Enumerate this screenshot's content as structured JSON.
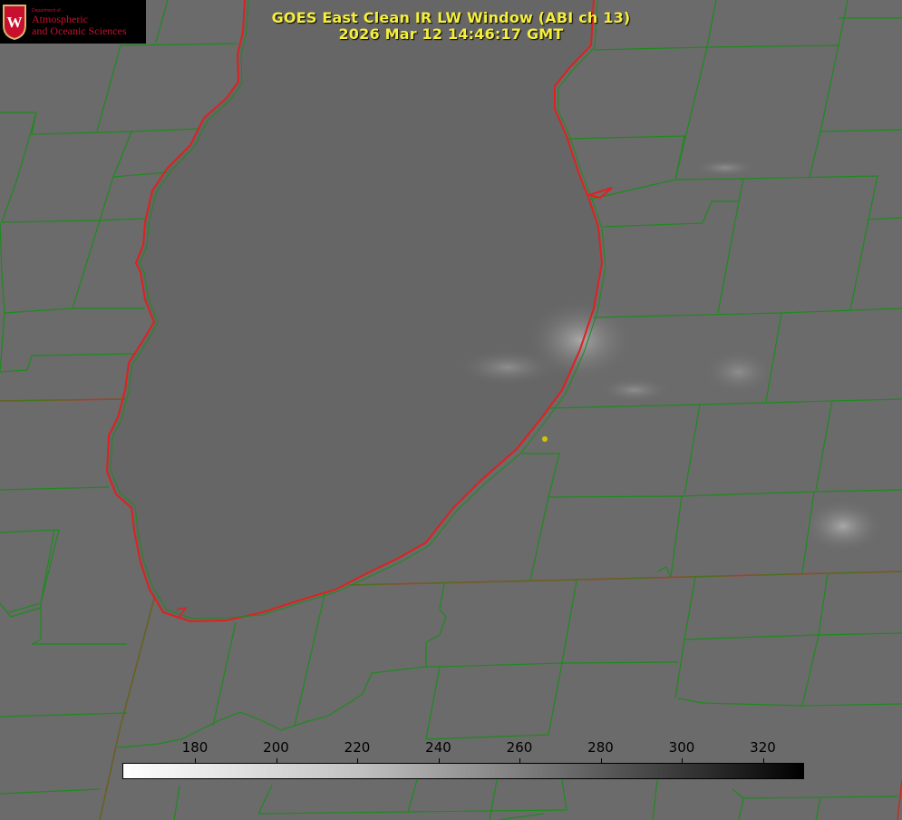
{
  "title": {
    "line1": "GOES East Clean IR LW Window (ABI ch 13)",
    "line2": "2026 Mar 12 14:46:17 GMT"
  },
  "logo": {
    "small": "Department of",
    "line1": "Atmospheric",
    "line2": "and Oceanic Sciences",
    "letter": "W"
  },
  "colorbar": {
    "ticks": [
      "180",
      "200",
      "220",
      "240",
      "260",
      "280",
      "300",
      "320"
    ]
  },
  "colors": {
    "title": "#f5ef3a",
    "county_lines": "#1e8a1e",
    "state_lines": "#e02020",
    "marker": "#d4c400",
    "logo_text": "#c8102e"
  }
}
